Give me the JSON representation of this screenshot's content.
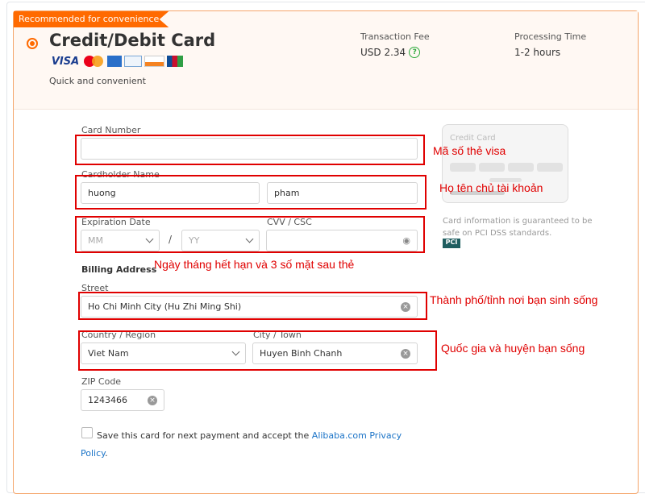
{
  "ribbon": "Recommended for convenience",
  "method": {
    "title": "Credit/Debit Card",
    "subtitle": "Quick and convenient",
    "logos": [
      "VISA",
      "Mastercard",
      "AMEX",
      "Diners Club",
      "DISCOVER",
      "JCB"
    ]
  },
  "fee": {
    "label": "Transaction Fee",
    "value": "USD 2.34",
    "help_icon": "question-circle-icon"
  },
  "processing": {
    "label": "Processing Time",
    "value": "1-2 hours"
  },
  "form": {
    "card_number": {
      "label": "Card Number",
      "value": ""
    },
    "cardholder": {
      "label": "Cardholder Name",
      "first": "huong",
      "last": "pham"
    },
    "expiration": {
      "label": "Expiration Date",
      "month_placeholder": "MM",
      "year_placeholder": "YY",
      "separator": "/"
    },
    "cvv": {
      "label": "CVV / CSC",
      "value": ""
    },
    "billing_title": "Billing Address",
    "street": {
      "label": "Street",
      "value": "Ho Chi Minh City (Hu Zhi Ming Shi)"
    },
    "country": {
      "label": "Country / Region",
      "value": "Viet Nam"
    },
    "city": {
      "label": "City / Town",
      "value": "Huyen Binh Chanh"
    },
    "zip": {
      "label": "ZIP Code",
      "value": "1243466"
    },
    "save": {
      "text": "Save this card for next payment and accept the ",
      "link": "Alibaba.com Privacy Policy",
      "end": "."
    }
  },
  "card_preview": {
    "label": "Credit Card",
    "security_note": "Card information is guaranteed to be safe on PCI DSS standards.",
    "pci_logo": "PCI Security Standards Council"
  },
  "annotations": {
    "card_number": "Mã số thẻ visa",
    "name": "Họ tên chủ tài khoản",
    "expiry": "Ngày tháng hết hạn và 3 số mặt sau thẻ",
    "street": "Thành phố/tỉnh nơi bạn sinh sống",
    "country": "Quốc gia và huyện bạn sống"
  },
  "colors": {
    "accent": "#ff6a00",
    "annotation": "#e00000",
    "link": "#1a73c7"
  }
}
